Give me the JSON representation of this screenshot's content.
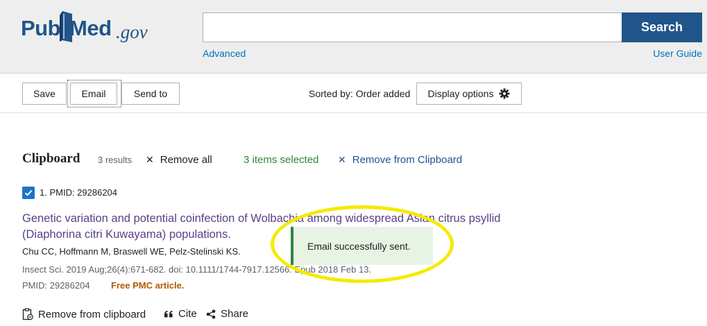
{
  "header": {
    "logo": {
      "part1": "Pub",
      "part2": "Med",
      "suffix": ".gov"
    },
    "search": {
      "value": "",
      "placeholder": ""
    },
    "search_button": "Search",
    "advanced_link": "Advanced",
    "user_guide_link": "User Guide"
  },
  "toolbar": {
    "save_label": "Save",
    "email_label": "Email",
    "send_to_label": "Send to",
    "sorted_by": "Sorted by: Order added",
    "display_options_label": "Display options"
  },
  "clipboard": {
    "title": "Clipboard",
    "results_count": "3 results",
    "remove_all": "Remove all",
    "selected_count": "3 items selected",
    "remove_from_clipboard": "Remove from Clipboard"
  },
  "results": [
    {
      "checked": true,
      "number_pmid": "1. PMID: 29286204",
      "title": "Genetic variation and potential coinfection of Wolbachia among widespread Asian citrus psyllid (Diaphorina citri Kuwayama) populations.",
      "authors": "Chu CC, Hoffmann M, Braswell WE, Pelz-Stelinski KS.",
      "citation": "Insect Sci. 2019 Aug;26(4):671-682. doi: 10.1111/1744-7917.12566. Epub 2018 Feb 13.",
      "pmid": "PMID: 29286204",
      "free_pmc": "Free PMC article.",
      "actions": {
        "remove": "Remove from clipboard",
        "cite": "Cite",
        "share": "Share"
      }
    }
  ],
  "toast": {
    "message": "Email successfully sent."
  },
  "colors": {
    "brand_blue": "#20558a",
    "link_blue": "#0071bc",
    "success_green": "#2e8540",
    "visited_title": "#5b3f86",
    "free_pmc": "#b35a00",
    "highlight_yellow": "#f5ea00"
  },
  "icons": {
    "logo_book": "book-icon",
    "display_options": "gear-icon",
    "remove": "close-icon",
    "checkbox": "checkmark-icon",
    "remove_clipboard": "clipboard-remove-icon",
    "cite": "quote-icon",
    "share": "share-icon"
  }
}
